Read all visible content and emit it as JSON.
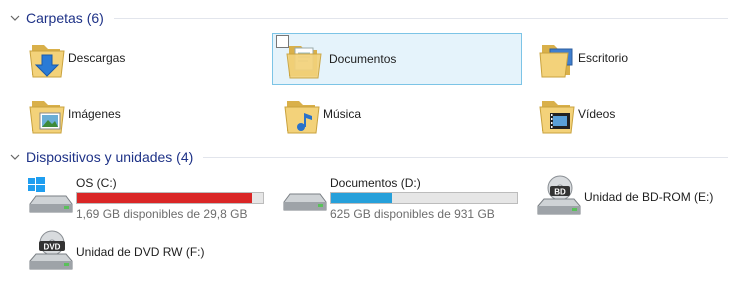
{
  "colors": {
    "header_text": "#1e3287",
    "bar_full": "#da2626",
    "bar_normal": "#26a0da",
    "selection_bg": "#e5f3fb"
  },
  "folders_group": {
    "title": "Carpetas (6)",
    "items": [
      {
        "label": "Descargas",
        "icon": "downloads-folder-icon",
        "selected": false
      },
      {
        "label": "Documentos",
        "icon": "documents-folder-icon",
        "selected": true
      },
      {
        "label": "Escritorio",
        "icon": "desktop-folder-icon",
        "selected": false
      },
      {
        "label": "Imágenes",
        "icon": "pictures-folder-icon",
        "selected": false
      },
      {
        "label": "Música",
        "icon": "music-folder-icon",
        "selected": false
      },
      {
        "label": "Vídeos",
        "icon": "videos-folder-icon",
        "selected": false
      }
    ]
  },
  "drives_group": {
    "title": "Dispositivos y unidades (4)",
    "drives": [
      {
        "name": "OS (C:)",
        "free_text": "1,69 GB disponibles de 29,8 GB",
        "used_fraction": 0.943,
        "icon": "windows-drive-icon"
      },
      {
        "name": "Documentos (D:)",
        "free_text": "625 GB disponibles de 931 GB",
        "used_fraction": 0.329,
        "icon": "hard-drive-icon"
      },
      {
        "name": "Unidad de BD-ROM (E:)",
        "icon": "bd-drive-icon",
        "badge": "BD"
      },
      {
        "name": "Unidad de DVD RW (F:)",
        "icon": "dvd-drive-icon",
        "badge": "DVD"
      }
    ]
  }
}
